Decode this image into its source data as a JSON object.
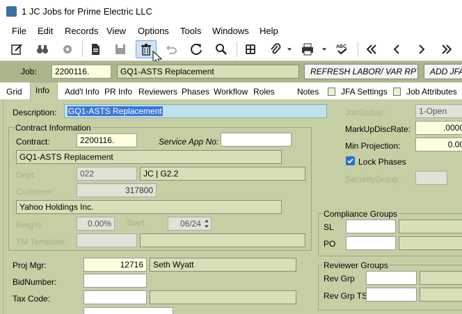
{
  "window": {
    "title": "1 JC Jobs for Prime Electric LLC"
  },
  "menu": [
    "File",
    "Edit",
    "Records",
    "View",
    "Options",
    "Tools",
    "Windows",
    "Help"
  ],
  "toolbar": {
    "icons": [
      "edit-icon",
      "binoculars-icon",
      "gear-icon",
      "document-icon",
      "save-icon",
      "trash-icon",
      "undo-icon",
      "refresh-icon",
      "search-icon",
      "calculator-icon",
      "paperclip-icon",
      "print-icon",
      "spellcheck-icon",
      "first-record-icon",
      "previous-record-icon",
      "next-record-icon",
      "last-record-icon"
    ]
  },
  "job": {
    "label": "Job:",
    "number": "2200116.",
    "description": "GQ1-ASTS Replacement",
    "refresh_button": "REFRESH LABOR/ VAR RPT",
    "add_button": "ADD JFA"
  },
  "tabs": [
    "Grid",
    "Info",
    "Add'l Info",
    "PR Info",
    "Reviewers",
    "Phases",
    "Workflow",
    "Roles",
    "Notes",
    "JFA Settings",
    "Job Attributes"
  ],
  "selected_tab": "Info",
  "info": {
    "description_label": "Description:",
    "description": "GQ1-ASTS Replacement",
    "contract_group": "Contract Information",
    "contract_label": "Contract:",
    "contract": "2200116.",
    "service_app_label": "Service App No:",
    "service_app": "",
    "contract_desc": "GQ1-ASTS Replacement",
    "dept_label": "Dept:",
    "dept": "022",
    "dept_desc": "JC | G2.2",
    "customer_label": "Customer:",
    "customer": "317800",
    "customer_name": "Yahoo Holdings Inc.",
    "retg_label": "Retg%:",
    "retg": "0.00%",
    "start_label": "Start",
    "start": "06/24",
    "tm_template_label": "TM Template:",
    "proj_mgr_label": "Proj Mgr:",
    "proj_mgr": "12716",
    "proj_mgr_name": "Seth Wyatt",
    "bid_number_label": "BidNumber:",
    "tax_code_label": "Tax Code:",
    "job_status_label": "JobStatus:",
    "job_status": "1-Open",
    "markup_label": "MarkUpDiscRate:",
    "markup": ".0000",
    "min_projection_label": "Min Projection:",
    "min_projection": "0.00",
    "lock_phases_label": "Lock Phases",
    "lock_phases": true,
    "security_group_label": "SecurityGroup:",
    "compliance_group": "Compliance Groups",
    "sl_label": "SL",
    "po_label": "PO",
    "reviewer_group": "Reviewer Groups",
    "rev_grp_label": "Rev Grp",
    "rev_grp_ts_label": "Rev Grp TS:"
  }
}
